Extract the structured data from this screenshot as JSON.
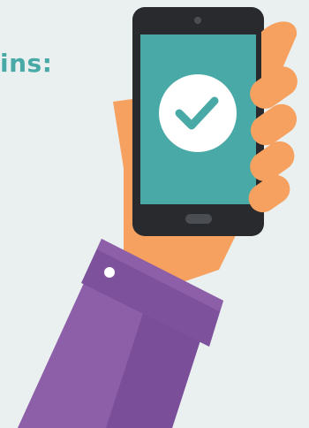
{
  "heading": {
    "text": "ins:",
    "color": "#48a9a6"
  },
  "illustration": {
    "icon": "hand-holding-phone-checkmark-icon",
    "colors": {
      "background": "#eaf0f0",
      "phone_body": "#282a2d",
      "phone_screen": "#48a9a6",
      "checkmark_circle": "#ffffff",
      "checkmark": "#48a9a6",
      "skin": "#f6a160",
      "sleeve": "#8c5fa8",
      "sleeve_shadow": "#7a4e98",
      "cuff": "#7d519c",
      "button": "#ffffff"
    }
  }
}
